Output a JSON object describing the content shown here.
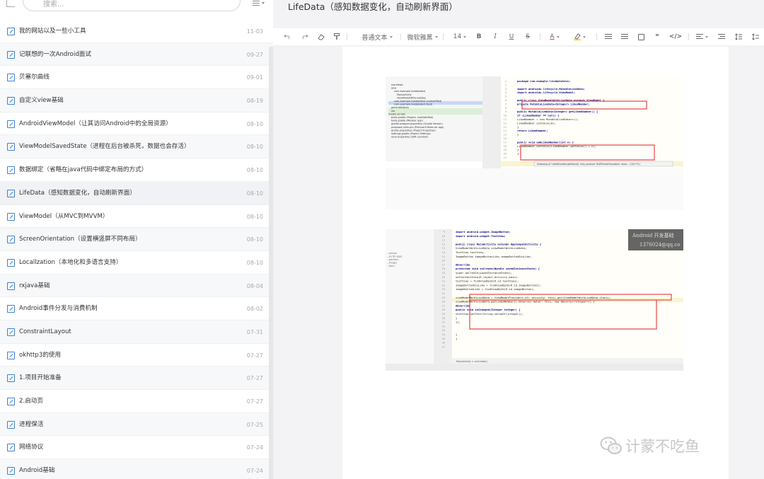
{
  "sidebar": {
    "search_placeholder": "搜索...",
    "items": [
      {
        "title": "我的网站以及一些小工具",
        "date": "11-03"
      },
      {
        "title": "记联想的一次Android面试",
        "date": "09-27"
      },
      {
        "title": "贝塞尔曲线",
        "date": "09-01"
      },
      {
        "title": "自定义view基础",
        "date": "08-19"
      },
      {
        "title": "AndroidViewModel（让其访问Android中的全局资源）",
        "date": "08-10"
      },
      {
        "title": "ViewModelSavedState（进程在后台被杀死，数据也会存活）",
        "date": "08-10"
      },
      {
        "title": "数据绑定（省略在java代码中绑定布局的方式）",
        "date": "08-10"
      },
      {
        "title": "LifeData（感知数据变化，自动刷新界面）",
        "date": "08-10"
      },
      {
        "title": "ViewModel（从MVC到MVVM）",
        "date": "08-10"
      },
      {
        "title": "ScreenOrientation（设置横竖屏不同布局）",
        "date": "08-10"
      },
      {
        "title": "Locallzation（本地化和多语言支持）",
        "date": "08-10"
      },
      {
        "title": "rxjava基础",
        "date": "08-04"
      },
      {
        "title": "Android事件分发与消费机制",
        "date": "08-02"
      },
      {
        "title": "ConstraintLayout",
        "date": "07-31"
      },
      {
        "title": "okhttp3的使用",
        "date": "07-27"
      },
      {
        "title": "1.项目开始准备",
        "date": "07-27"
      },
      {
        "title": "2.启动页",
        "date": "07-27"
      },
      {
        "title": "进程保活",
        "date": "07-25"
      },
      {
        "title": "网络协议",
        "date": "07-24"
      },
      {
        "title": "Android基础",
        "date": "07-24"
      }
    ]
  },
  "editor": {
    "title": "LifeData（感知数据变化，自动刷新界面）",
    "toolbar": {
      "paragraph_style": "普通文本",
      "font": "微软雅黑",
      "font_size": "14",
      "bold": "B",
      "italic": "I",
      "underline": "U",
      "strike": "S",
      "font_color": "A",
      "quote": "❝",
      "code": "</>"
    },
    "colors": {
      "accent": "#3e7fd9",
      "font_color_bar": "#e53935",
      "highlight_bar": "#f5d100"
    }
  },
  "screenshot1": {
    "tree": [
      "manifests",
      "java",
      "com.example.livedatatest",
      "MainActivity",
      "ViewModelWithLiveData",
      "com.example.livedatatest (androidTest)",
      "com.example.livedatatest (test)",
      "generatedJava",
      "res",
      "Gradle Scripts",
      "build.gradle (Project: LiveDataTest)",
      "build.gradle (Module: app)",
      "gradle-wrapper.properties (Gradle Version)",
      "proguard-rules.pro (ProGuard Rules for app)",
      "gradle.properties (Project Properties)",
      "settings.gradle (Project Settings)",
      "local.properties (SDK Location)"
    ],
    "line_numbers": [
      "1",
      "2",
      "3",
      "4",
      "5",
      "6",
      "7",
      "8",
      "9",
      "10",
      "11",
      "12",
      "13",
      "14",
      "15",
      "16",
      "17",
      "18",
      "19",
      "20",
      "21"
    ],
    "code": [
      "package com.example.livedatatest;",
      "",
      "import androidx.lifecycle.MutableLiveData;",
      "import androidx.lifecycle.ViewModel;",
      "",
      "public class ViewModelWithLiveData extends ViewModel {",
      "    private MutableLiveData<Integer> LikedNumber;",
      "",
      "    public MutableLiveData<Integer> getLikedNumber() {",
      "        if (LikedNumber == null) {",
      "            LikedNumber = new MutableLiveData<>();",
      "            LikedNumber.setValue(0);",
      "        }",
      "        return LikedNumber;",
      "    }",
      "",
      "    public void addLikedNumber(int n) {",
      "        LikedNumber.setValue(LikedNumber.getValue() + n);",
      "    }",
      "}",
      ""
    ],
    "tooltip": "Unboxing of 'LikedNumber.getValue()' may produce 'NullPointerException' more... (Ctrl+F1)"
  },
  "screenshot2": {
    "tree": [
      "...rences",
      "...es for app)",
      "...perties)",
      "...ttings)",
      "...tion)"
    ],
    "line_numbers": [
      "9",
      "10",
      "11",
      "12",
      "13",
      "14",
      "15",
      "16",
      "17",
      "18",
      "19",
      "20",
      "21",
      "22",
      "23",
      "24",
      "25",
      "26",
      "27",
      "28",
      "29",
      "30",
      "31",
      "32",
      "33",
      "34",
      "35",
      "36",
      "37"
    ],
    "code": [
      "import android.widget.ImageButton;",
      "import android.widget.TextView;",
      "",
      "public class MainActivity extends AppCompatActivity {",
      "    ViewModelWithLiveData viewModelWithLiveData;",
      "    TextView textView;",
      "    ImageButton imageButtonLike,imageButtonDisLike;",
      "",
      "    @Override",
      "    protected void onCreate(Bundle savedInstanceState) {",
      "        super.onCreate(savedInstanceState);",
      "        setContentView(R.layout.activity_main);",
      "        textView = findViewById(R.id.textView);",
      "        imageButtonDisLike = findViewById(R.id.imageButton2);",
      "        imageButtonLike = findViewById(R.id.imageButton);",
      "",
      "        viewModelWithLiveData = ViewModelProviders.of( activity: this).get(ViewModelWithLiveData.class);",
      "        viewModelWithLiveData.getLikedNumber().observe( owner: this, new Observer<Integer>() {",
      "            @Override",
      "            public void onChanged(Integer integer) {",
      "                textView.setText(String.valueOf(integer));",
      "            }",
      "        });",
      "",
      "",
      "    }",
      "}",
      "",
      ""
    ],
    "overlay_line1": "Android 开发基础",
    "overlay_line2": "1376024@qq.co",
    "breadcrumb": "MainActivity  >  onCreate()"
  },
  "watermark": {
    "text": "计蒙不吃鱼"
  }
}
